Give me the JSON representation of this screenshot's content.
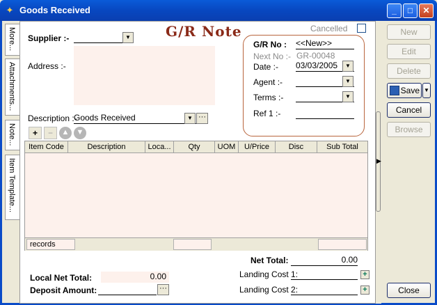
{
  "window": {
    "title": "Goods Received"
  },
  "side_tabs": [
    "More...",
    "Attachments...",
    "Note...",
    "Item Template..."
  ],
  "header": {
    "heading": "G/R Note",
    "cancelled_label": "Cancelled",
    "supplier_label": "Supplier :-",
    "address_label": "Address :-",
    "description_label": "Description :-",
    "description_value": "Goods Received"
  },
  "gr_panel": {
    "gr_no_label": "G/R No :",
    "gr_no_value": "<<New>>",
    "next_no_label": "Next No :-",
    "next_no_value": "GR-00048",
    "date_label": "Date :-",
    "date_value": "03/03/2005",
    "agent_label": "Agent :-",
    "terms_label": "Terms :-",
    "ref1_label": "Ref 1 :-"
  },
  "grid": {
    "columns": [
      "Item Code",
      "Description",
      "Loca...",
      "Qty",
      "UOM",
      "U/Price",
      "Disc",
      "Sub Total"
    ],
    "footer_records": "records"
  },
  "totals": {
    "net_total_label": "Net Total:",
    "net_total_value": "0.00",
    "landing_cost1_label": "Landing Cost 1:",
    "landing_cost2_label": "Landing Cost 2:",
    "local_net_total_label": "Local Net Total:",
    "local_net_total_value": "0.00",
    "deposit_amount_label": "Deposit Amount:"
  },
  "buttons": {
    "new": "New",
    "edit": "Edit",
    "delete": "Delete",
    "save": "Save",
    "cancel": "Cancel",
    "browse": "Browse",
    "close": "Close"
  }
}
